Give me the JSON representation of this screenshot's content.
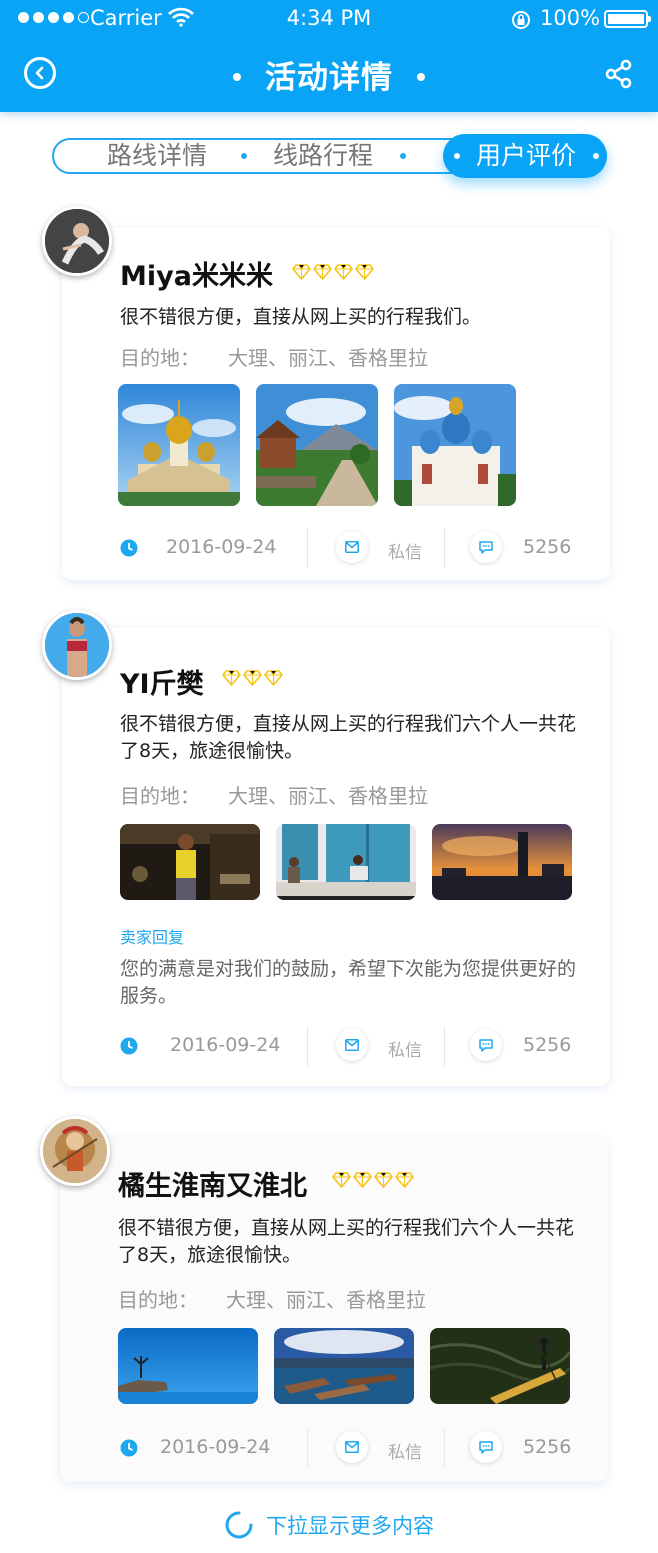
{
  "status_bar": {
    "carrier": "Carrier",
    "time": "4:34 PM",
    "battery": "100%"
  },
  "nav": {
    "title": "活动详情"
  },
  "tabs": [
    {
      "label": "路线详情",
      "active": false
    },
    {
      "label": "线路行程",
      "active": false
    },
    {
      "label": "用户评价",
      "active": true
    }
  ],
  "reviews": [
    {
      "name": "Miya米米米",
      "gem_count": 4,
      "comment": "很不错很方便，直接从网上买的行程我们。",
      "dest_label": "目的地：",
      "dest_value": "大理、丽江、香格里拉",
      "photos": [
        "photo-golden-domes",
        "photo-village-road",
        "photo-blue-domes"
      ],
      "reply_label": null,
      "reply_text": null,
      "date": "2016-09-24",
      "message_label": "私信",
      "comment_count": "5256"
    },
    {
      "name": "YI斤樊",
      "gem_count": 3,
      "comment": "很不错很方便，直接从网上买的行程我们六个人一共花了8天，旅途很愉快。",
      "dest_label": "目的地：",
      "dest_value": "大理、丽江、香格里拉",
      "photos": [
        "photo-market-man",
        "photo-blue-doors",
        "photo-sunset-skyline"
      ],
      "reply_label": "卖家回复",
      "reply_text": "您的满意是对我们的鼓励，希望下次能为您提供更好的服务。",
      "date": "2016-09-24",
      "message_label": "私信",
      "comment_count": "5256"
    },
    {
      "name": "橘生淮南又淮北",
      "gem_count": 4,
      "comment": "很不错很方便，直接从网上买的行程我们六个人一共花了8天，旅途很愉快。",
      "dest_label": "目的地：",
      "dest_value": "大理、丽江、香格里拉",
      "photos": [
        "photo-cliff-jump",
        "photo-boats-lake",
        "photo-bamboo-raft"
      ],
      "reply_label": null,
      "reply_text": null,
      "date": "2016-09-24",
      "message_label": "私信",
      "comment_count": "5256"
    }
  ],
  "load_more": "下拉显示更多内容",
  "colors": {
    "primary": "#0aa4f6",
    "gem": "#f5c518"
  }
}
